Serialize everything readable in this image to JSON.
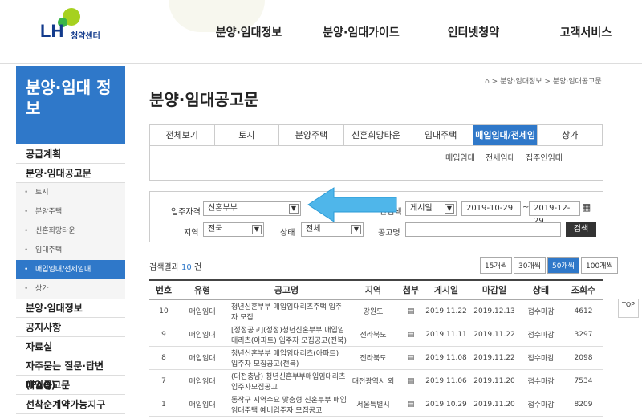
{
  "logo": {
    "brand": "LH",
    "sub": "청약센터"
  },
  "gnb": [
    "분양·임대정보",
    "분양·임대가이드",
    "인터넷청약",
    "고객서비스"
  ],
  "sidebar": {
    "title": "분양·임대 정보",
    "items": [
      {
        "label": "공급계획",
        "level": 1
      },
      {
        "label": "분양·임대공고문",
        "level": 1
      },
      {
        "label": "토지",
        "level": 2
      },
      {
        "label": "분양주택",
        "level": 2
      },
      {
        "label": "신혼희망타운",
        "level": 2
      },
      {
        "label": "임대주택",
        "level": 2
      },
      {
        "label": "매입임대/전세임대",
        "level": 2,
        "active": true
      },
      {
        "label": "상가",
        "level": 2
      },
      {
        "label": "분양·임대정보",
        "level": 1
      },
      {
        "label": "공지사항",
        "level": 1
      },
      {
        "label": "자료실",
        "level": 1
      },
      {
        "label": "자주묻는 질문·답변(FAQ)",
        "level": 1
      },
      {
        "label": "매입공고문",
        "level": 1
      },
      {
        "label": "선착순계약가능지구",
        "level": 1
      }
    ]
  },
  "breadcrumb": "> 분양·임대정보 > 분양·임대공고문",
  "page_title": "분양·임대공고문",
  "tabs": [
    "전체보기",
    "토지",
    "분양주택",
    "신혼희망타운",
    "임대주택",
    "매입임대/전세임대",
    "상가"
  ],
  "subtabs": [
    "매입임대",
    "전세임대",
    "집주인임대"
  ],
  "search": {
    "type_label": "입주자격",
    "type_value": "신혼부부",
    "period_label": "간검색",
    "period_value": "게시일",
    "date_from": "2019-10-29",
    "date_to": "2019-12-29",
    "region_label": "지역",
    "region_value": "전국",
    "status_label": "상태",
    "status_value": "전체",
    "name_label": "공고명",
    "button": "검색"
  },
  "result": {
    "prefix": "검색결과",
    "count": "10",
    "suffix": "건"
  },
  "page_sizes": [
    "15개씩",
    "30개씩",
    "50개씩",
    "100개씩"
  ],
  "columns": [
    "번호",
    "유형",
    "공고명",
    "지역",
    "첨부",
    "게시일",
    "마감일",
    "상태",
    "조회수"
  ],
  "rows": [
    {
      "no": "10",
      "type": "매입임대",
      "title": "청년신혼부부 매입임대리츠주택 입주자 모집",
      "region": "강원도",
      "posted": "2019.11.22",
      "deadline": "2019.12.13",
      "status": "접수마감",
      "views": "4612"
    },
    {
      "no": "9",
      "type": "매입임대",
      "title": "[정정공고](정정)청년신혼부부 매입임대리츠(아파트) 입주자 모집공고(전북)",
      "region": "전라북도",
      "posted": "2019.11.11",
      "deadline": "2019.11.22",
      "status": "접수마감",
      "views": "3297"
    },
    {
      "no": "8",
      "type": "매입임대",
      "title": "청년신혼부부 매입임대리츠(아파트) 입주자 모집공고(전북)",
      "region": "전라북도",
      "posted": "2019.11.08",
      "deadline": "2019.11.22",
      "status": "접수마감",
      "views": "2098"
    },
    {
      "no": "7",
      "type": "매입임대",
      "title": "(대전충남) 청년신혼부부매입임대리츠 입주자모집공고",
      "region": "대전광역시 외",
      "posted": "2019.11.06",
      "deadline": "2019.11.20",
      "status": "접수마감",
      "views": "7534"
    },
    {
      "no": "1",
      "type": "매입임대",
      "title": "동작구 지역수요 맞춤형 신혼부부 매입임대주택 예비입주자 모집공고",
      "region": "서울특별시",
      "posted": "2019.10.29",
      "deadline": "2019.11.20",
      "status": "접수마감",
      "views": "8209"
    }
  ],
  "top_button": "TOP",
  "colors": {
    "accent": "#2f78c9",
    "brand": "#123a8c",
    "logo_green": "#a6d11f"
  }
}
